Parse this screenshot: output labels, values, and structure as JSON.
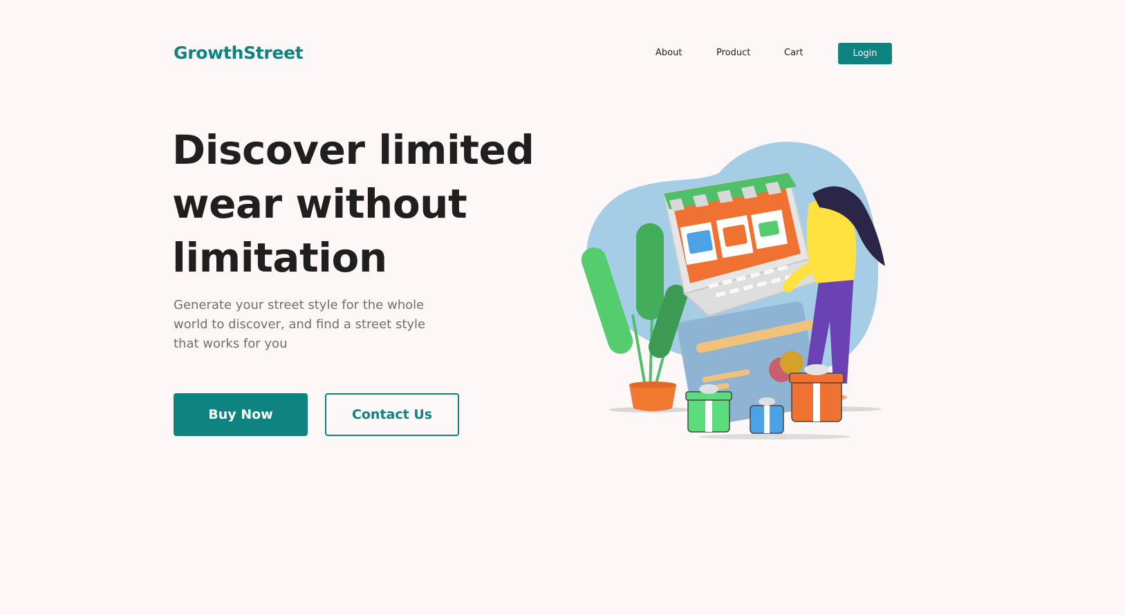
{
  "header": {
    "logo": "GrowthStreet",
    "nav": [
      {
        "label": "About"
      },
      {
        "label": "Product"
      },
      {
        "label": "Cart"
      }
    ],
    "login_label": "Login"
  },
  "hero": {
    "title_lines": [
      "Discover limited",
      "wear without",
      "limitation"
    ],
    "subtitle_lines": [
      "Generate your street style for the whole",
      "world to discover, and find a street style",
      "that works for you"
    ],
    "buy_label": "Buy Now",
    "contact_label": "Contact Us"
  },
  "colors": {
    "brand": "#0e8380",
    "background": "#fdf7f7",
    "text": "#1f1f1f",
    "muted": "#6f6f6f"
  },
  "illustration": {
    "name": "online-shop-illustration"
  }
}
